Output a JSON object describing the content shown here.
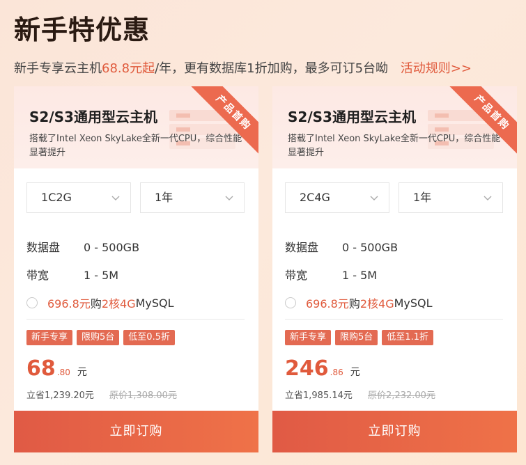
{
  "page": {
    "title": "新手特优惠",
    "subtitle_prefix": "新手专享云主机",
    "subtitle_price": "68.8元起",
    "subtitle_suffix": "/年，更有数据库1折加购，最多可订5台呦",
    "rules_link": "活动规则>>"
  },
  "colors": {
    "accent": "#e05a3c",
    "ribbon": "#ec6a4f",
    "button": "#e96349"
  },
  "cards": [
    {
      "title": "S2/S3通用型云主机",
      "description": "搭载了Intel Xeon SkyLake全新一代CPU，综合性能显著提升",
      "ribbon": "产品首购",
      "config_select": "1C2G",
      "duration_select": "1年",
      "disk_label": "数据盘",
      "disk_value": "0 - 500GB",
      "bandwidth_label": "带宽",
      "bandwidth_value": "1 - 5M",
      "addon_price": "696.8元",
      "addon_mid": "购",
      "addon_spec": "2核4G",
      "addon_suffix": "MySQL",
      "tags": [
        "新手专享",
        "限购5台",
        "低至0.5折"
      ],
      "price_int": "68",
      "price_dec": ".80",
      "price_unit": "元",
      "save_text": "立省1,239.20元",
      "original_price": "原价1,308.00元",
      "buy_label": "立即订购"
    },
    {
      "title": "S2/S3通用型云主机",
      "description": "搭载了Intel Xeon SkyLake全新一代CPU，综合性能显著提升",
      "ribbon": "产品首购",
      "config_select": "2C4G",
      "duration_select": "1年",
      "disk_label": "数据盘",
      "disk_value": "0 - 500GB",
      "bandwidth_label": "带宽",
      "bandwidth_value": "1 - 5M",
      "addon_price": "696.8元",
      "addon_mid": "购",
      "addon_spec": "2核4G",
      "addon_suffix": "MySQL",
      "tags": [
        "新手专享",
        "限购5台",
        "低至1.1折"
      ],
      "price_int": "246",
      "price_dec": ".86",
      "price_unit": "元",
      "save_text": "立省1,985.14元",
      "original_price": "原价2,232.00元",
      "buy_label": "立即订购"
    }
  ]
}
